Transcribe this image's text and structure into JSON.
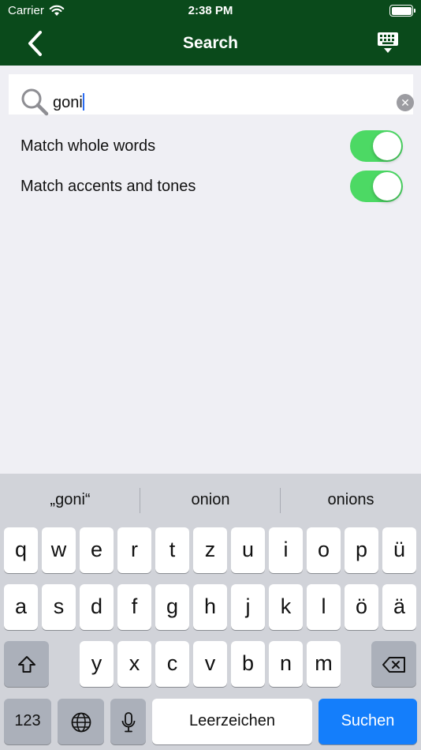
{
  "status": {
    "carrier": "Carrier",
    "time": "2:38 PM"
  },
  "nav": {
    "title": "Search"
  },
  "search": {
    "query": "goni"
  },
  "options": [
    {
      "label": "Match whole words",
      "on": true
    },
    {
      "label": "Match accents and tones",
      "on": true
    }
  ],
  "suggestions": [
    "„goni“",
    "onion",
    "onions"
  ],
  "keys": {
    "row1": [
      "q",
      "w",
      "e",
      "r",
      "t",
      "z",
      "u",
      "i",
      "o",
      "p",
      "ü"
    ],
    "row2": [
      "a",
      "s",
      "d",
      "f",
      "g",
      "h",
      "j",
      "k",
      "l",
      "ö",
      "ä"
    ],
    "row3": [
      "y",
      "x",
      "c",
      "v",
      "b",
      "n",
      "m"
    ],
    "numbers": "123",
    "space": "Leerzeichen",
    "return": "Suchen"
  },
  "colors": {
    "nav": "#0a4a1b",
    "toggle": "#4cd964",
    "return_key": "#147efb"
  }
}
